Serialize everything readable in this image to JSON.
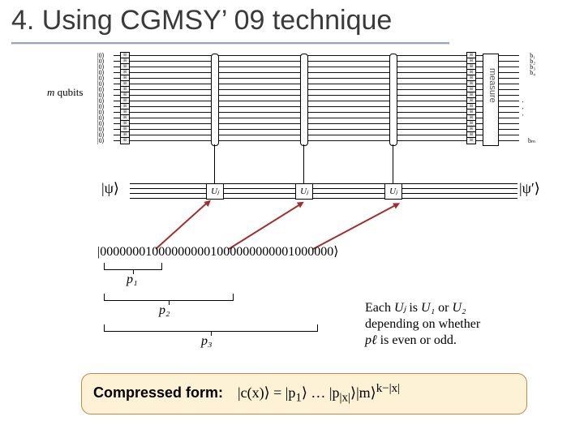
{
  "title": "4. Using CGMSY’ 09 technique",
  "circuit": {
    "m_qubits_label_prefix": "m",
    "m_qubits_label_suffix": " qubits",
    "num_top_wires": 16,
    "ket_label": "|0⟩",
    "gate_label": "H",
    "num_controls": 3,
    "measure_label": "measure",
    "output_bits": [
      "b₁",
      "b₂",
      "b₃",
      "b₄",
      "bₘ"
    ],
    "dots": "· · ·"
  },
  "bottom": {
    "psi_in": "|ψ⟩",
    "psi_out": "|ψ′⟩",
    "uj_label": "Uⱼ"
  },
  "bitstring": "|000000010000000001000000000001000000⟩",
  "p_labels": [
    "p₁",
    "p₂",
    "p₃"
  ],
  "explain": {
    "line1_a": "Each ",
    "line1_b": "Uⱼ",
    "line1_c": " is ",
    "line1_d": "U₁",
    "line1_e": " or ",
    "line1_f": "U₂",
    "line2_a": "depending on whether",
    "line3_a": "pℓ",
    "line3_b": " is even or odd."
  },
  "compressed": {
    "label": "Compressed form:",
    "formula": "|c(x)⟩ = |p₁⟩ … |p₍|x|₎⟩ |m⟩^{k−|x|}"
  }
}
